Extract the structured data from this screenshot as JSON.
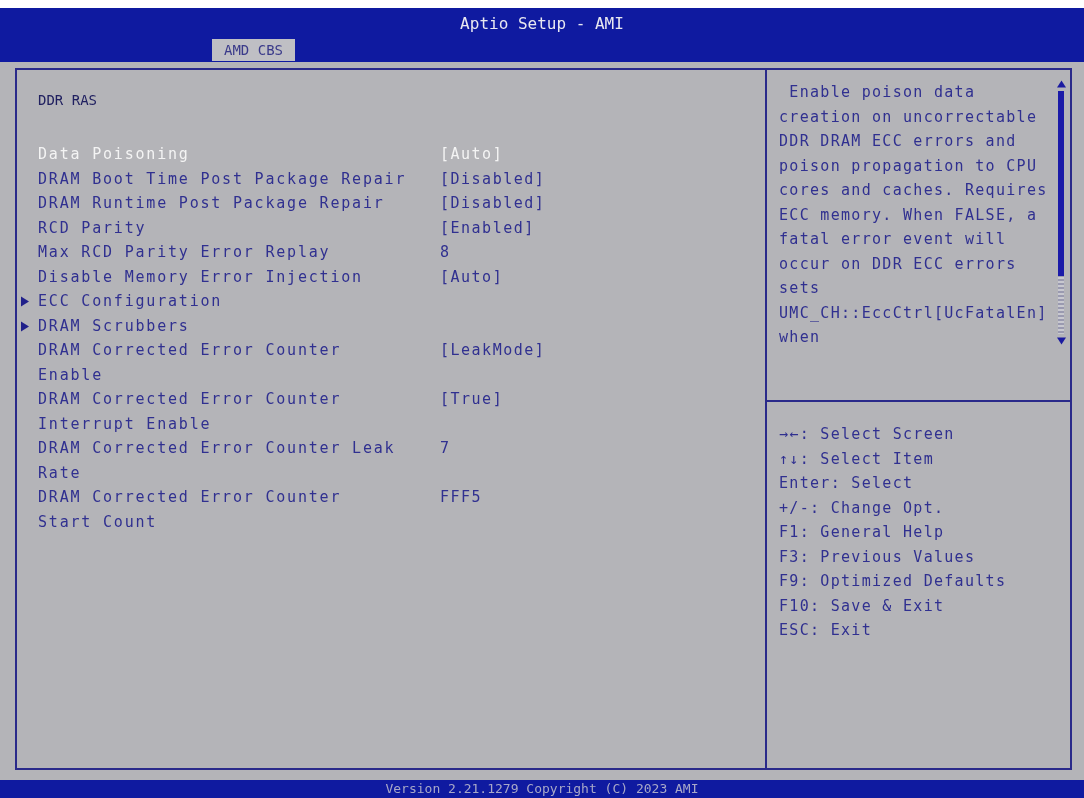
{
  "window": {
    "title": "Aptio Setup - AMI"
  },
  "tabs": [
    {
      "label": "AMD CBS",
      "selected": true
    }
  ],
  "section_title": "DDR RAS",
  "items": [
    {
      "kind": "setting",
      "label": "Data Poisoning",
      "value": "[Auto]",
      "selected": true
    },
    {
      "kind": "setting",
      "label": "DRAM Boot Time Post Package Repair",
      "value": "[Disabled]",
      "selected": false
    },
    {
      "kind": "setting",
      "label": "DRAM Runtime Post Package Repair",
      "value": "[Disabled]",
      "selected": false
    },
    {
      "kind": "setting",
      "label": "RCD Parity",
      "value": "[Enabled]",
      "selected": false
    },
    {
      "kind": "setting",
      "label": "Max RCD Parity Error Replay",
      "value": "8",
      "selected": false
    },
    {
      "kind": "setting",
      "label": "Disable Memory Error Injection",
      "value": "[Auto]",
      "selected": false
    },
    {
      "kind": "submenu",
      "label": "ECC Configuration",
      "selected": false
    },
    {
      "kind": "submenu",
      "label": "DRAM Scrubbers",
      "selected": false
    },
    {
      "kind": "setting",
      "label": "DRAM Corrected Error Counter\nEnable",
      "value": "[LeakMode]",
      "selected": false
    },
    {
      "kind": "setting",
      "label": "DRAM Corrected Error Counter\nInterrupt Enable",
      "value": "[True]",
      "selected": false
    },
    {
      "kind": "setting",
      "label": "DRAM Corrected Error Counter Leak\nRate",
      "value": "7",
      "selected": false
    },
    {
      "kind": "setting",
      "label": "DRAM Corrected Error Counter\nStart Count",
      "value": "FFF5",
      "selected": false
    }
  ],
  "help_lines": [
    " Enable poison data",
    "creation on uncorrectable",
    "DDR DRAM ECC errors and",
    "poison propagation to CPU",
    "cores and caches. Requires",
    "ECC memory. When FALSE, a",
    "fatal error event will",
    "occur on DDR ECC errors",
    "sets",
    "UMC_CH::EccCtrl[UcFatalEn]",
    "when"
  ],
  "key_help": [
    "→←: Select Screen",
    "↑↓: Select Item",
    "Enter: Select",
    "+/-: Change Opt.",
    "F1: General Help",
    "F3: Previous Values",
    "F9: Optimized Defaults",
    "F10: Save & Exit",
    "ESC: Exit"
  ],
  "status_bar": "Version 2.21.1279 Copyright (C) 2023 AMI"
}
